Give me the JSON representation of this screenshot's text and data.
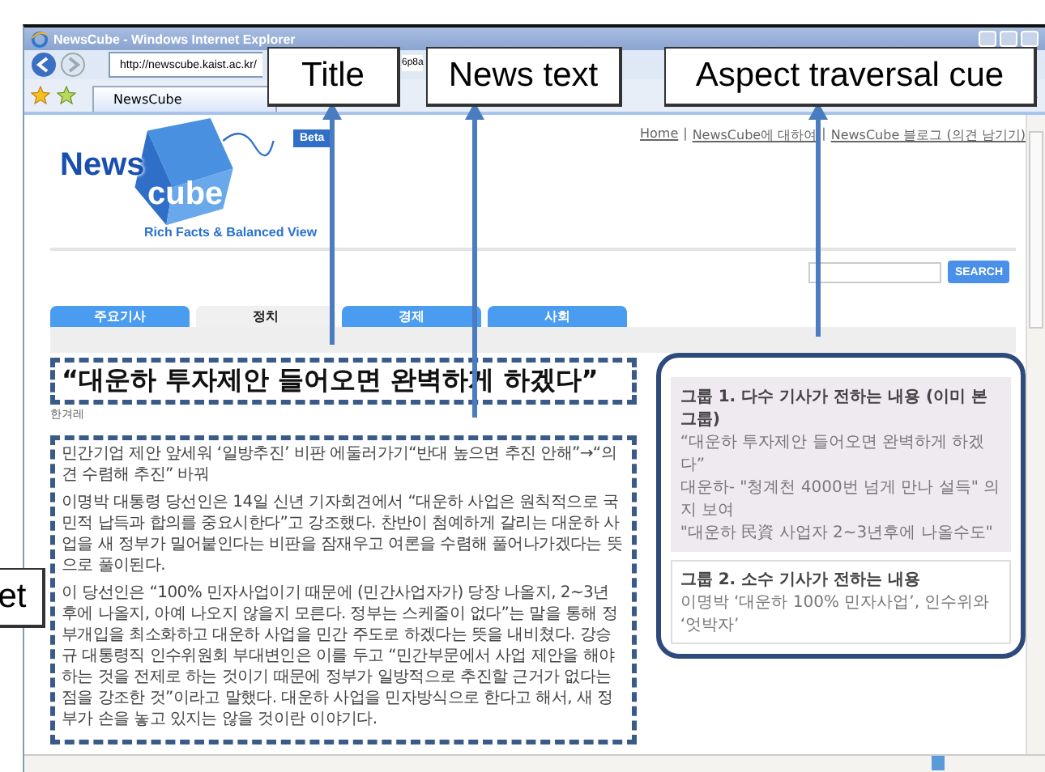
{
  "window": {
    "title": "NewsCube - Windows Internet Explorer"
  },
  "address_bar": {
    "parts": [
      "http://newscube.kaist.ac.kr/",
      "6p8a"
    ]
  },
  "browser_tab": {
    "label": "NewsCube"
  },
  "top_links": [
    {
      "kind": "link",
      "text": "Home"
    },
    {
      "kind": "sep",
      "text": "|"
    },
    {
      "kind": "link",
      "text": "NewsCube에 대하여"
    },
    {
      "kind": "sep",
      "text": "|"
    },
    {
      "kind": "link",
      "text": "NewsCube 블로그 (의견 남기기)"
    }
  ],
  "logo": {
    "word_1": "News",
    "word_2": "cube",
    "badge": "Beta",
    "tagline": "Rich Facts & Balanced View"
  },
  "search": {
    "button": "SEARCH"
  },
  "tabs": [
    {
      "label": "주요기사",
      "selected": false
    },
    {
      "label": "정치",
      "selected": true
    },
    {
      "label": "경제",
      "selected": false
    },
    {
      "label": "사회",
      "selected": false
    }
  ],
  "article": {
    "headline": "“대운하 투자제안 들어오면 완벽하게 하겠다”",
    "source": "한겨레",
    "paragraphs": [
      "민간기업 제안 앞세워 ‘일방추진’ 비판 에둘러가기“반대 높으면 추진 안해”→“의견 수렴해 추진” 바꿔",
      "이명박 대통령 당선인은 14일 신년 기자회견에서 “대운하 사업은 원칙적으로 국민적 납득과 합의를 중요시한다”고 강조했다. 찬반이 첨예하게 갈리는 대운하 사업을 새 정부가 밀어붙인다는 비판을 잠재우고 여론을 수렴해 풀어나가겠다는 뜻으로 풀이된다.",
      "이 당선인은 “100% 민자사업이기 때문에 (민간사업자가) 당장 나올지, 2~3년 후에 나올지, 아예 나오지 않을지 모른다. 정부는 스케줄이 없다”는 말을 통해 정부개입을 최소화하고 대운하 사업을 민간 주도로 하겠다는 뜻을 내비쳤다. 강승규 대통령직 인수위원회 부대변인은 이를 두고 “민간부문에서 사업 제안을 해야 하는 것을 전제로 하는 것이기 때문에 정부가 일방적으로 추진할 근거가 없다는 점을 강조한 것”이라고 말했다. 대운하 사업을 민자방식으로 한다고 해서, 새 정부가 손을 놓고 있지는 않을 것이란 이야기다."
    ]
  },
  "aspect_groups": [
    {
      "title": "그룹 1. 다수 기사가 전하는 내용 (이미 본 그룹)",
      "seen": true,
      "items": [
        "“대운하 투자제안 들어오면 완벽하게 하겠다”",
        "대운하- \"청계천 4000번 넘게 만나 설득\" 의지 보여",
        "\"대운하 民資 사업자 2~3년후에 나올수도\""
      ]
    },
    {
      "title": "그룹 2. 소수 기사가 전하는 내용",
      "seen": false,
      "items": [
        "이명박 ‘대운하 100% 민자사업’, 인수위와 ‘엇박자’"
      ]
    }
  ],
  "callouts": [
    {
      "text": "Title"
    },
    {
      "text": "News text"
    },
    {
      "text": "Aspect traversal cue"
    },
    {
      "text": "et"
    }
  ]
}
